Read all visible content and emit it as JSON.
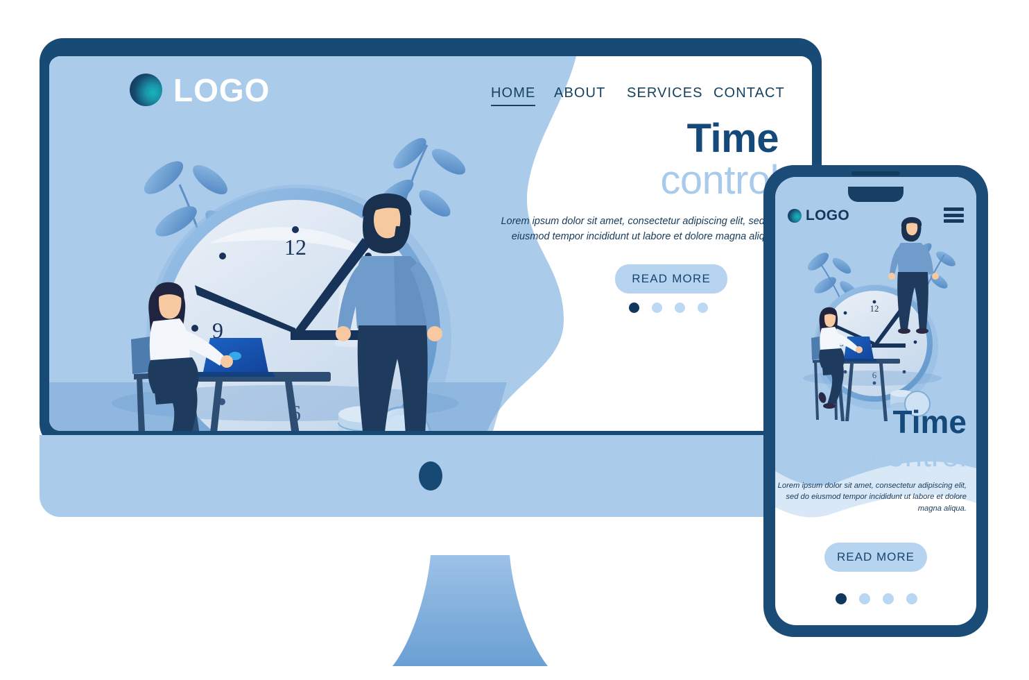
{
  "brand": {
    "name": "LOGO",
    "logo_icon": "circle-gradient-logo-icon"
  },
  "nav": {
    "items": [
      {
        "label": "HOME",
        "active": true
      },
      {
        "label": "ABOUT",
        "active": false
      },
      {
        "label": "SERVICES",
        "active": false
      },
      {
        "label": "CONTACT",
        "active": false
      }
    ]
  },
  "hero": {
    "title": "Time",
    "subtitle": "control",
    "body": "Lorem ipsum dolor sit amet, consectetur adipiscing elit, sed do eiusmod tempor incididunt ut labore et dolore magna aliqua.",
    "cta_label": "READ MORE",
    "carousel_dots": 4,
    "carousel_active_index": 0
  },
  "phone": {
    "brand_name": "LOGO",
    "menu_icon": "hamburger-menu-icon",
    "title": "Time",
    "subtitle": "control",
    "body": "Lorem ipsum dolor sit amet, consectetur adipiscing elit, sed do eiusmod tempor incididunt ut labore et dolore magna aliqua.",
    "cta_label": "READ MORE",
    "carousel_dots": 4,
    "carousel_active_index": 0
  },
  "illustration": {
    "name": "time-control-illustration",
    "clock_numerals": [
      "12",
      "9",
      "6"
    ],
    "elements": [
      "wall-clock",
      "seated-woman-with-laptop",
      "standing-man",
      "coin-stack",
      "desk",
      "chair",
      "leaf-branches"
    ]
  },
  "colors": {
    "frame_navy": "#174a74",
    "panel_blue": "#abcbeb",
    "accent_light_blue": "#b6d3f0",
    "title_navy": "#14497a",
    "subtitle_blue": "#a9cbeb",
    "dot_active": "#10375e",
    "dot_inactive": "#bcd8f4",
    "white": "#ffffff"
  }
}
